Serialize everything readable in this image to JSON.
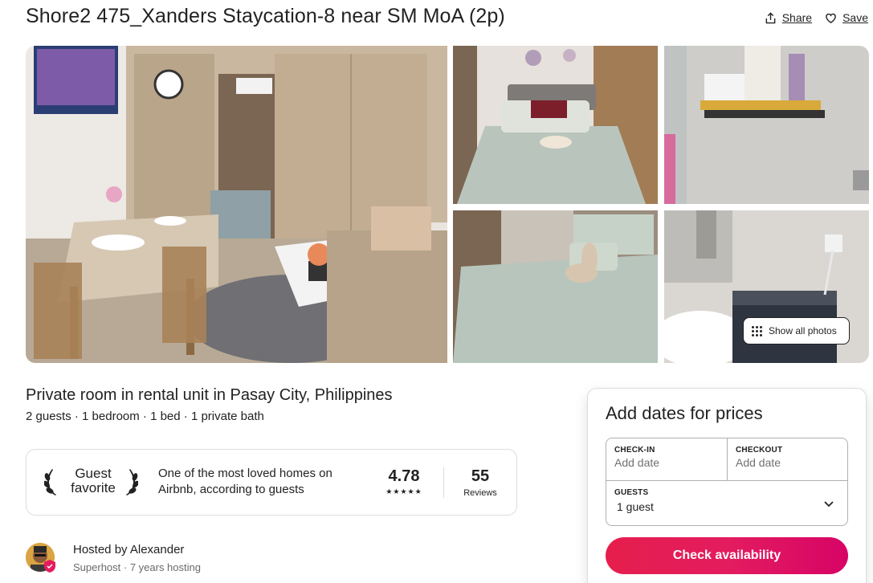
{
  "listing": {
    "title": "Shore2 475_Xanders Staycation-8 near SM MoA (2p)",
    "subtitle": "Private room in rental unit in Pasay City, Philippines",
    "details": "2 guests · 1 bedroom · 1 bed · 1 private bath"
  },
  "actions": {
    "share_label": "Share",
    "save_label": "Save",
    "share_icon": "share-icon",
    "save_icon": "heart-icon"
  },
  "gallery": {
    "show_all_label": "Show all photos",
    "photos": [
      "living-dining-room-photo",
      "bedroom-photo",
      "bathroom-shelf-photo",
      "bed-towels-photo",
      "bathroom-sink-washer-photo"
    ]
  },
  "guest_favorite": {
    "badge_line1": "Guest",
    "badge_line2": "favorite",
    "description": "One of the most loved homes on Airbnb, according to guests",
    "rating": "4.78",
    "stars": "★★★★★",
    "reviews_count": "55",
    "reviews_label": "Reviews"
  },
  "host": {
    "hosted_by": "Hosted by Alexander",
    "meta": "Superhost · 7 years hosting"
  },
  "booking": {
    "title": "Add dates for prices",
    "checkin_label": "CHECK-IN",
    "checkin_value": "Add date",
    "checkout_label": "CHECKOUT",
    "checkout_value": "Add date",
    "guests_label": "GUESTS",
    "guests_value": "1 guest",
    "button_label": "Check availability"
  },
  "colors": {
    "brand": "#e61e4d",
    "text": "#222222",
    "muted": "#6a6a6a",
    "border": "#dddddd"
  }
}
